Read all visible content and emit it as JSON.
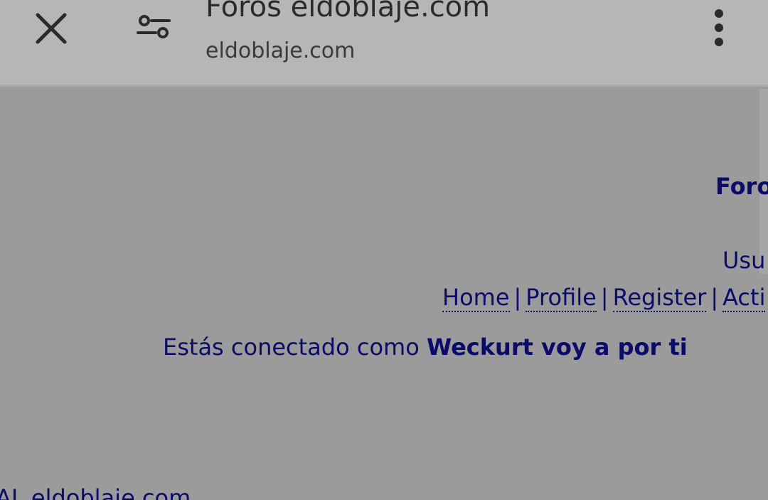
{
  "browser": {
    "title": "Foros eldoblaje.com",
    "url": "eldoblaje.com",
    "icons": {
      "close": "close-icon",
      "tune": "tune-icon",
      "menu": "more-vert-icon"
    }
  },
  "page": {
    "site_title": "Foros",
    "user_label": "Usu",
    "nav": {
      "home": "Home",
      "profile": "Profile",
      "register": "Register",
      "active": "Acti",
      "separator": "|"
    },
    "login_prefix": "Estás conectado como ",
    "login_user": "Weckurt voy a por ti",
    "footer_domain": "AL eldoblaje.com"
  },
  "colors": {
    "link": "#0b0b6a",
    "page_bg": "#9b9b9b",
    "topbar_bg": "#b6b6b7"
  }
}
